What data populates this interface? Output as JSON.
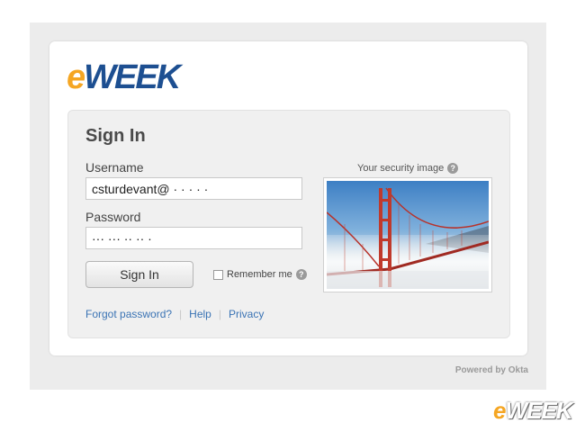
{
  "brand": {
    "logo_e": "e",
    "logo_rest": "WEEK",
    "accent_orange": "#f5a623",
    "accent_blue": "#1d4f91"
  },
  "signin": {
    "title": "Sign In",
    "username_label": "Username",
    "username_value": "csturdevant@ ·  ·  ·  ·  · ",
    "password_label": "Password",
    "password_value": "··· ··· ·· ··  ·",
    "signin_button": "Sign In",
    "remember_label": "Remember me",
    "remember_checked": false,
    "help_glyph": "?"
  },
  "links": {
    "forgot": "Forgot password?",
    "help": "Help",
    "privacy": "Privacy",
    "separator": "|"
  },
  "security": {
    "label": "Your security image",
    "image_icon": "golden-gate-bridge-image"
  },
  "footer": {
    "powered_by": "Powered by Okta"
  },
  "watermark": {
    "e": "e",
    "rest": "WEEK"
  }
}
